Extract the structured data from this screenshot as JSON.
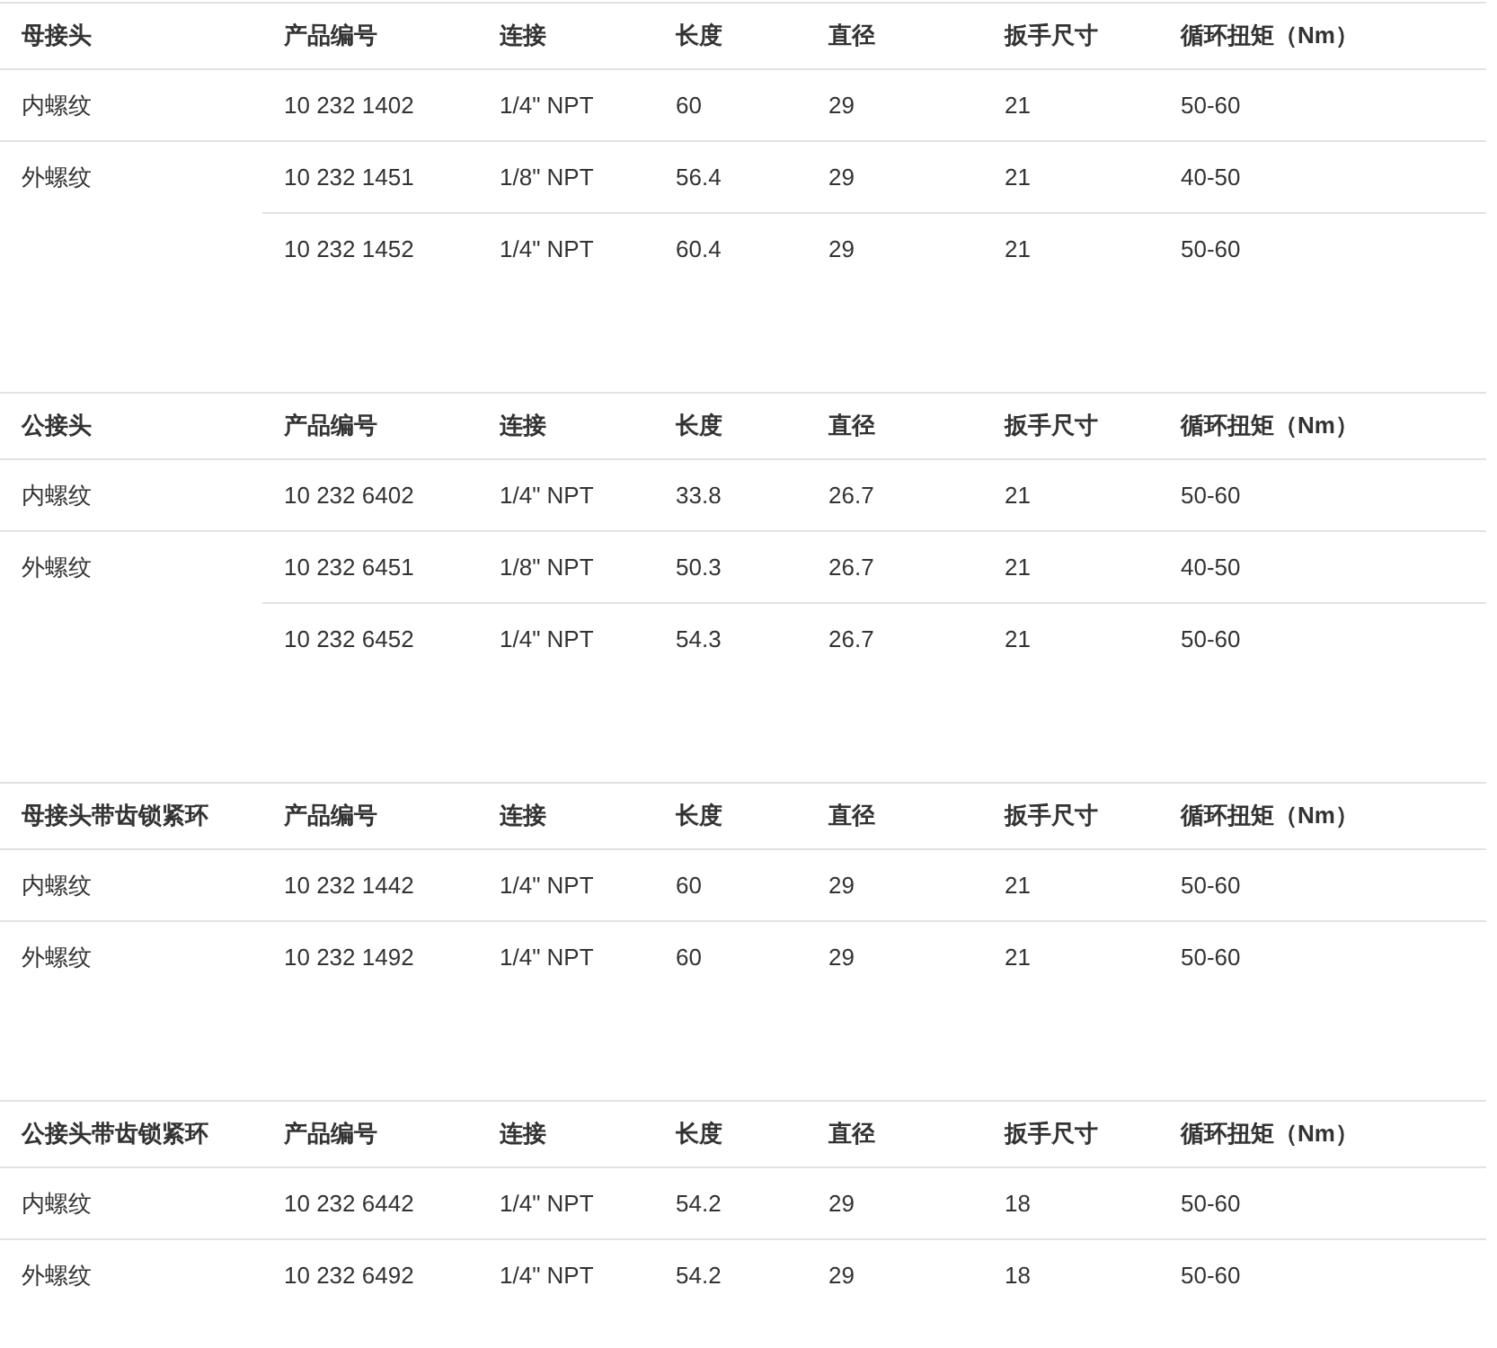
{
  "tables": [
    {
      "columns": [
        "母接头",
        "产品编号",
        "连接",
        "长度",
        "直径",
        "扳手尺寸",
        "循环扭矩（Nm）"
      ],
      "rows": [
        {
          "cells": [
            "内螺纹",
            "10 232 1402",
            "1/4\" NPT",
            "60",
            "29",
            "21",
            "50-60"
          ]
        },
        {
          "cells": [
            {
              "text": "外螺纹",
              "rowspan": 2
            },
            "10 232 1451",
            "1/8\" NPT",
            "56.4",
            "29",
            "21",
            "40-50"
          ]
        },
        {
          "cells": [
            "10 232 1452",
            "1/4\" NPT",
            "60.4",
            "29",
            "21",
            "50-60"
          ]
        }
      ]
    },
    {
      "columns": [
        "公接头",
        "产品编号",
        "连接",
        "长度",
        "直径",
        "扳手尺寸",
        "循环扭矩（Nm）"
      ],
      "rows": [
        {
          "cells": [
            "内螺纹",
            "10 232 6402",
            "1/4\" NPT",
            "33.8",
            "26.7",
            "21",
            "50-60"
          ]
        },
        {
          "cells": [
            {
              "text": "外螺纹",
              "rowspan": 2
            },
            "10 232 6451",
            "1/8\" NPT",
            "50.3",
            "26.7",
            "21",
            "40-50"
          ]
        },
        {
          "cells": [
            "10 232 6452",
            "1/4\" NPT",
            "54.3",
            "26.7",
            "21",
            "50-60"
          ]
        }
      ]
    },
    {
      "columns": [
        "母接头带齿锁紧环",
        "产品编号",
        "连接",
        "长度",
        "直径",
        "扳手尺寸",
        "循环扭矩（Nm）"
      ],
      "rows": [
        {
          "cells": [
            "内螺纹",
            "10 232 1442",
            "1/4\" NPT",
            "60",
            "29",
            "21",
            "50-60"
          ]
        },
        {
          "cells": [
            "外螺纹",
            "10 232 1492",
            "1/4\" NPT",
            "60",
            "29",
            "21",
            "50-60"
          ]
        }
      ]
    },
    {
      "columns": [
        "公接头带齿锁紧环",
        "产品编号",
        "连接",
        "长度",
        "直径",
        "扳手尺寸",
        "循环扭矩（Nm）"
      ],
      "rows": [
        {
          "cells": [
            "内螺纹",
            "10 232 6442",
            "1/4\" NPT",
            "54.2",
            "29",
            "18",
            "50-60"
          ]
        },
        {
          "cells": [
            "外螺纹",
            "10 232 6492",
            "1/4\" NPT",
            "54.2",
            "29",
            "18",
            "50-60"
          ]
        }
      ]
    }
  ]
}
